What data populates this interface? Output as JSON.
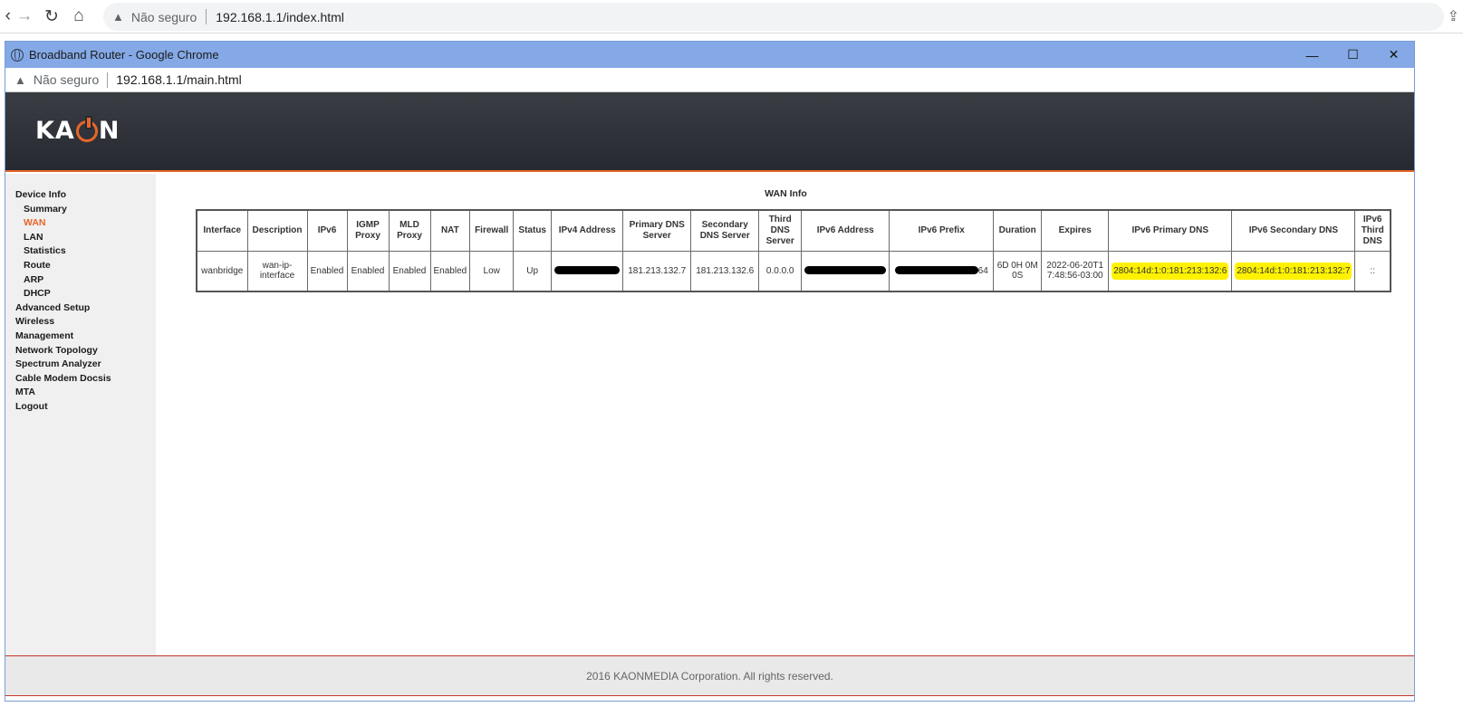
{
  "outer": {
    "security_label": "Não seguro",
    "url": "192.168.1.1/index.html"
  },
  "popup": {
    "window_title": "Broadband Router - Google Chrome",
    "security_label": "Não seguro",
    "url": "192.168.1.1/main.html"
  },
  "brand": {
    "logo_text_left": "KA",
    "logo_text_right": "N"
  },
  "sidebar": {
    "items": [
      {
        "label": "Device Info",
        "sub": false,
        "active": false
      },
      {
        "label": "Summary",
        "sub": true,
        "active": false
      },
      {
        "label": "WAN",
        "sub": true,
        "active": true
      },
      {
        "label": "LAN",
        "sub": true,
        "active": false
      },
      {
        "label": "Statistics",
        "sub": true,
        "active": false
      },
      {
        "label": "Route",
        "sub": true,
        "active": false
      },
      {
        "label": "ARP",
        "sub": true,
        "active": false
      },
      {
        "label": "DHCP",
        "sub": true,
        "active": false
      },
      {
        "label": "Advanced Setup",
        "sub": false,
        "active": false
      },
      {
        "label": "Wireless",
        "sub": false,
        "active": false
      },
      {
        "label": "Management",
        "sub": false,
        "active": false
      },
      {
        "label": "Network Topology",
        "sub": false,
        "active": false
      },
      {
        "label": "Spectrum Analyzer",
        "sub": false,
        "active": false
      },
      {
        "label": "Cable Modem Docsis",
        "sub": false,
        "active": false
      },
      {
        "label": "MTA",
        "sub": false,
        "active": false
      },
      {
        "label": "Logout",
        "sub": false,
        "active": false
      }
    ]
  },
  "wan": {
    "title": "WAN Info",
    "headers": {
      "interface": "Interface",
      "description": "Description",
      "ipv6": "IPv6",
      "igmp_proxy": "IGMP Proxy",
      "mld_proxy": "MLD Proxy",
      "nat": "NAT",
      "firewall": "Firewall",
      "status": "Status",
      "ipv4_address": "IPv4 Address",
      "primary_dns": "Primary DNS Server",
      "secondary_dns": "Secondary DNS Server",
      "third_dns": "Third DNS Server",
      "ipv6_address": "IPv6 Address",
      "ipv6_prefix": "IPv6 Prefix",
      "duration": "Duration",
      "expires": "Expires",
      "ipv6_primary_dns": "IPv6 Primary DNS",
      "ipv6_secondary_dns": "IPv6 Secondary DNS",
      "ipv6_third_dns": "IPv6 Third DNS"
    },
    "row": {
      "interface": "wanbridge",
      "description": "wan-ip-interface",
      "ipv6": "Enabled",
      "igmp_proxy": "Enabled",
      "mld_proxy": "Enabled",
      "nat": "Enabled",
      "firewall": "Low",
      "status": "Up",
      "primary_dns": "181.213.132.7",
      "secondary_dns": "181.213.132.6",
      "third_dns": "0.0.0.0",
      "ipv6_prefix_suffix": "64",
      "duration": "6D 0H 0M 0S",
      "expires": "2022-06-20T17:48:56-03:00",
      "ipv6_primary_dns": "2804:14d:1:0:181:213:132:6",
      "ipv6_secondary_dns": "2804:14d:1:0:181:213:132:7",
      "ipv6_third_dns": "::"
    }
  },
  "footer": {
    "copyright": "2016 KAONMEDIA Corporation. All rights reserved."
  },
  "colors": {
    "accent": "#e8662a",
    "highlight": "#fff200",
    "titlebar": "#84a9e6"
  }
}
